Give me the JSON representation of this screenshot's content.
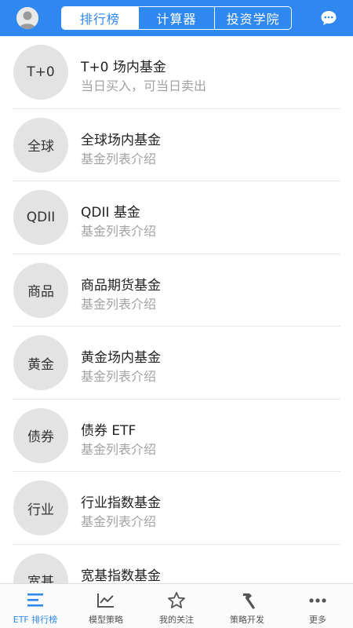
{
  "header": {
    "tabs": [
      {
        "label": "排行榜",
        "active": true
      },
      {
        "label": "计算器",
        "active": false
      },
      {
        "label": "投资学院",
        "active": false
      }
    ],
    "avatar_icon": "user-avatar-icon",
    "chat_icon": "chat-bubble-icon"
  },
  "list": {
    "items": [
      {
        "badge": "T+0",
        "title": "T+0 场内基金",
        "subtitle": "当日买入，可当日卖出"
      },
      {
        "badge": "全球",
        "title": "全球场内基金",
        "subtitle": "基金列表介绍"
      },
      {
        "badge": "QDII",
        "title": "QDII 基金",
        "subtitle": "基金列表介绍"
      },
      {
        "badge": "商品",
        "title": "商品期货基金",
        "subtitle": "基金列表介绍"
      },
      {
        "badge": "黄金",
        "title": "黄金场内基金",
        "subtitle": "基金列表介绍"
      },
      {
        "badge": "债券",
        "title": "债券 ETF",
        "subtitle": "基金列表介绍"
      },
      {
        "badge": "行业",
        "title": "行业指数基金",
        "subtitle": "基金列表介绍"
      },
      {
        "badge": "宽基",
        "title": "宽基指数基金",
        "subtitle": ""
      }
    ]
  },
  "bottom_nav": {
    "items": [
      {
        "label": "ETF 排行榜",
        "icon": "ranking-bars-icon",
        "active": true
      },
      {
        "label": "模型策略",
        "icon": "line-chart-icon",
        "active": false
      },
      {
        "label": "我的关注",
        "icon": "star-icon",
        "active": false
      },
      {
        "label": "策略开发",
        "icon": "hammer-icon",
        "active": false
      },
      {
        "label": "更多",
        "icon": "more-dots-icon",
        "active": false
      }
    ]
  },
  "colors": {
    "brand_blue": "#2f88f0",
    "badge_gray": "#e3e3e3",
    "subtitle_gray": "#a2a2a2"
  }
}
